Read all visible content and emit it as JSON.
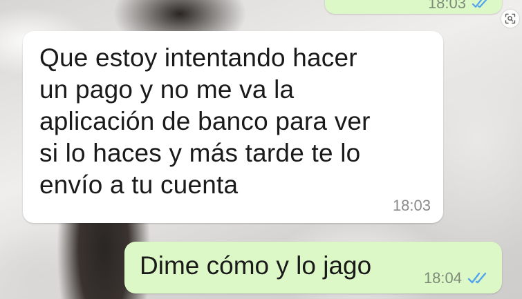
{
  "conversation": {
    "previous_outgoing": {
      "time": "18:03",
      "status_icon": "double-check-read-icon"
    },
    "incoming": {
      "lines": [
        "Que estoy intentando hacer",
        "un pago y no me va la",
        "aplicación de banco para ver",
        "si lo haces y más tarde te lo",
        "envío a tu cuenta"
      ],
      "time": "18:03"
    },
    "outgoing": {
      "text": "Dime cómo y lo jago",
      "time": "18:04",
      "status_icon": "double-check-read-icon"
    }
  },
  "colors": {
    "incoming_bubble": "#ffffff",
    "outgoing_bubble": "#dcf8c6",
    "read_ticks": "#4fa3f0"
  },
  "overlay": {
    "lens_icon": "image-search-icon"
  }
}
